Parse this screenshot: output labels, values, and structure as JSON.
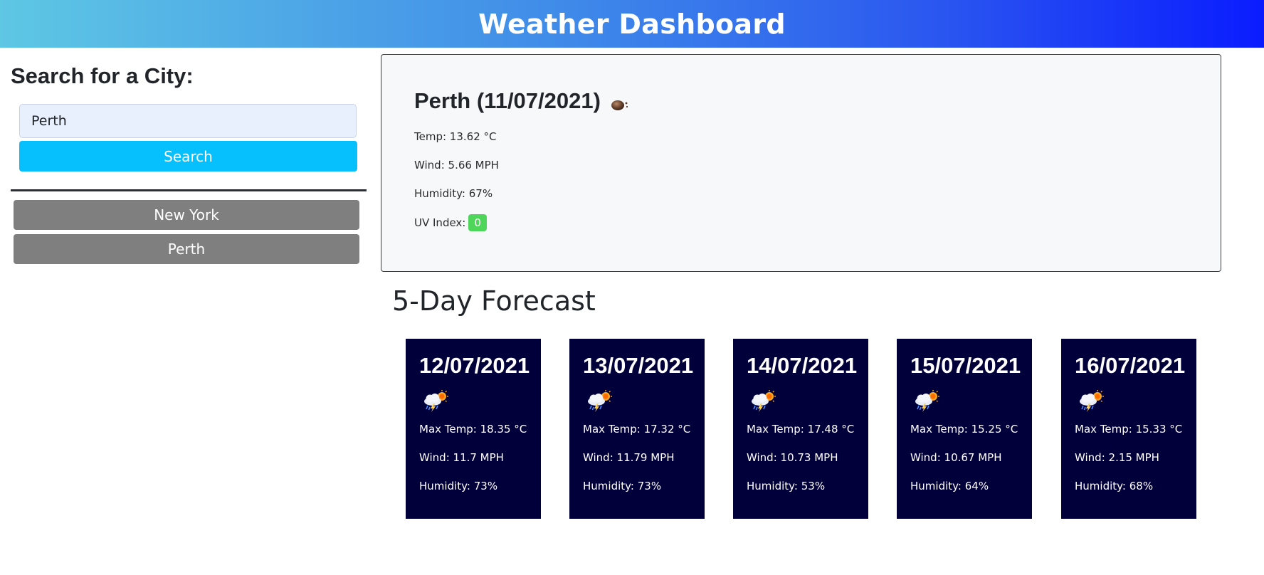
{
  "header": {
    "title": "Weather Dashboard"
  },
  "search": {
    "title": "Search for a City:",
    "input_value": "Perth",
    "button_label": "Search"
  },
  "history": [
    "New York",
    "Perth"
  ],
  "current": {
    "title": "Perth (11/07/2021)",
    "icon": "night-moon-icon",
    "temp": "Temp: 13.62 °C",
    "wind": "Wind: 5.66 MPH",
    "humidity": "Humidity: 67%",
    "uv_label": "UV Index:",
    "uv_value": "0",
    "uv_color": "#4ed65a"
  },
  "forecast": {
    "title": "5-Day Forecast",
    "card_color": "#02003a",
    "days": [
      {
        "date": "12/07/2021",
        "icon": "rain-sun-storm-icon",
        "temp": "Max Temp: 18.35 °C",
        "wind": "Wind: 11.7 MPH",
        "humidity": "Humidity: 73%"
      },
      {
        "date": "13/07/2021",
        "icon": "rain-sun-storm-icon",
        "temp": "Max Temp: 17.32 °C",
        "wind": "Wind: 11.79 MPH",
        "humidity": "Humidity: 73%"
      },
      {
        "date": "14/07/2021",
        "icon": "rain-sun-storm-icon",
        "temp": "Max Temp: 17.48 °C",
        "wind": "Wind: 10.73 MPH",
        "humidity": "Humidity: 53%"
      },
      {
        "date": "15/07/2021",
        "icon": "rain-sun-storm-icon",
        "temp": "Max Temp: 15.25 °C",
        "wind": "Wind: 10.67 MPH",
        "humidity": "Humidity: 64%"
      },
      {
        "date": "16/07/2021",
        "icon": "rain-sun-storm-icon",
        "temp": "Max Temp: 15.33 °C",
        "wind": "Wind: 2.15 MPH",
        "humidity": "Humidity: 68%"
      }
    ]
  }
}
